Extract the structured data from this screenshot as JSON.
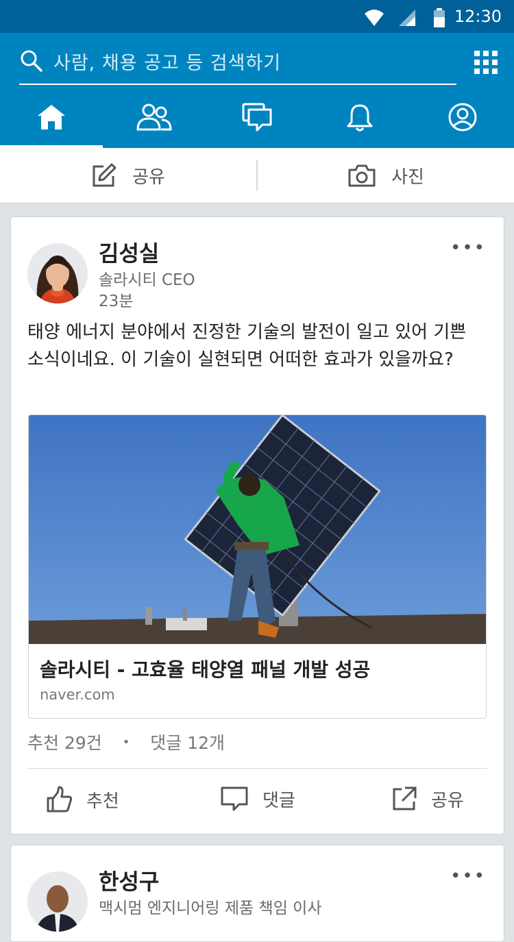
{
  "status_bar": {
    "time": "12:30"
  },
  "search": {
    "placeholder": "사람, 채용 공고 등 검색하기"
  },
  "nav_tabs": [
    "home-icon",
    "network-icon",
    "messages-icon",
    "notifications-icon",
    "profile-icon"
  ],
  "share_bar": {
    "share_label": "공유",
    "photo_label": "사진"
  },
  "posts": [
    {
      "author": "김성실",
      "headline": "솔라시티 CEO",
      "time": "23분",
      "text": "태양 에너지 분야에서 진정한 기술의 발전이 일고 있어 기쁜 소식이네요. 이 기술이 실현되면 어떠한 효과가 있을까요?",
      "link_title": "솔라시티 - 고효율 태양열 패널 개발 성공",
      "link_source": "naver.com",
      "likes": "추천 29건",
      "separator": "•",
      "comments": "댓글 12개",
      "actions": {
        "like": "추천",
        "comment": "댓글",
        "share": "공유"
      }
    },
    {
      "author": "한성구",
      "headline": "맥시멈 엔지니어링 제품 책임 이사"
    }
  ],
  "colors": {
    "statusbar": "#00619a",
    "appbar": "#0084bf",
    "background": "#dfe3e6"
  }
}
